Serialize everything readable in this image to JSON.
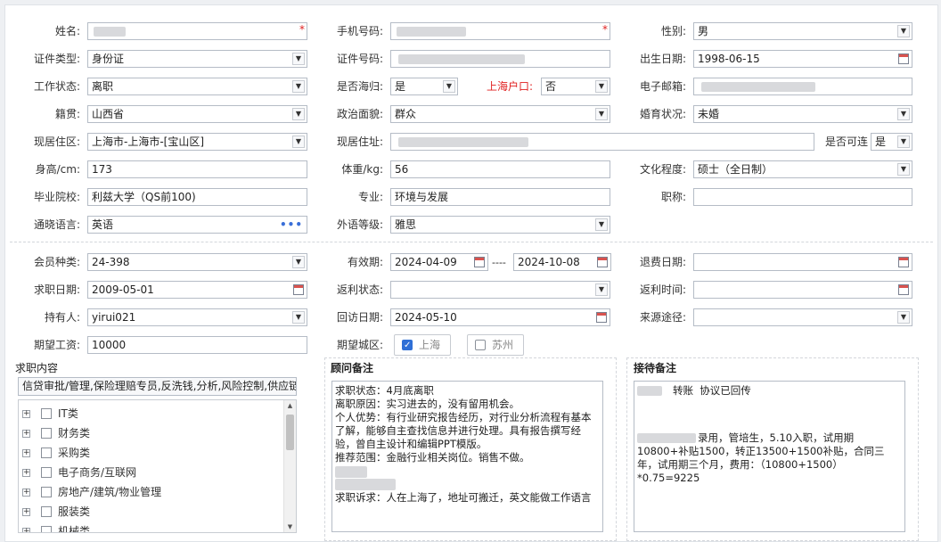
{
  "form": {
    "name": {
      "label": "姓名:"
    },
    "phone": {
      "label": "手机号码:"
    },
    "gender": {
      "label": "性别:",
      "value": "男"
    },
    "id_type": {
      "label": "证件类型:",
      "value": "身份证"
    },
    "id_number": {
      "label": "证件号码:"
    },
    "birth_date": {
      "label": "出生日期:",
      "value": "1998-06-15"
    },
    "work_status": {
      "label": "工作状态:",
      "value": "离职"
    },
    "returnee": {
      "label": "是否海归:",
      "value": "是"
    },
    "shanghai_hukou": {
      "label": "上海户口:",
      "value": "否"
    },
    "email": {
      "label": "电子邮箱:"
    },
    "native_place": {
      "label": "籍贯:",
      "value": "山西省"
    },
    "political_status": {
      "label": "政治面貌:",
      "value": "群众"
    },
    "marital_status": {
      "label": "婚育状况:",
      "value": "未婚"
    },
    "residence_area": {
      "label": "现居住区:",
      "value": "上海市-上海市-[宝山区]"
    },
    "residence_address": {
      "label": "现居住址:"
    },
    "contactable": {
      "label": "是否可连",
      "value": "是"
    },
    "height": {
      "label": "身高/cm:",
      "value": "173"
    },
    "weight": {
      "label": "体重/kg:",
      "value": "56"
    },
    "education": {
      "label": "文化程度:",
      "value": "硕士（全日制）"
    },
    "school": {
      "label": "毕业院校:",
      "value": "利兹大学（QS前100)"
    },
    "major": {
      "label": "专业:",
      "value": "环境与发展"
    },
    "title": {
      "label": "职称:",
      "value": ""
    },
    "languages": {
      "label": "通晓语言:",
      "value": "英语"
    },
    "language_level": {
      "label": "外语等级:",
      "value": "雅思"
    }
  },
  "membership": {
    "member_type": {
      "label": "会员种类:",
      "value": "24-398"
    },
    "valid_period": {
      "label": "有效期:",
      "from": "2024-04-09",
      "sep": "----",
      "to": "2024-10-08"
    },
    "refund_date": {
      "label": "退费日期:",
      "value": ""
    },
    "job_seek_date": {
      "label": "求职日期:",
      "value": "2009-05-01"
    },
    "rebate_status": {
      "label": "返利状态:",
      "value": ""
    },
    "rebate_time": {
      "label": "返利时间:",
      "value": ""
    },
    "holder": {
      "label": "持有人:",
      "value": "yirui021"
    },
    "visit_date": {
      "label": "回访日期:",
      "value": "2024-05-10"
    },
    "source": {
      "label": "来源途径:",
      "value": ""
    },
    "expected_salary": {
      "label": "期望工资:",
      "value": "10000"
    },
    "expected_city": {
      "label": "期望城区:",
      "options": [
        {
          "label": "上海",
          "checked": true
        },
        {
          "label": "苏州",
          "checked": false
        }
      ]
    }
  },
  "job_content": {
    "title": "求职内容",
    "summary": "信贷审批/管理,保险理赔专员,反洗钱,分析,风险控制,供应链",
    "tree": [
      "IT类",
      "财务类",
      "采购类",
      "电子商务/互联网",
      "房地产/建筑/物业管理",
      "服装类",
      "机械类"
    ]
  },
  "consultant_notes": {
    "title": "顾问备注",
    "lines": [
      "求职状态：4月底离职",
      "离职原因：实习进去的，没有留用机会。",
      "个人优势：有行业研究报告经历，对行业分析流程有基本了解，能够自主查找信息并进行处理。具有报告撰写经验，曾自主设计和编辑PPT模版。",
      "推荐范围：金融行业相关岗位。销售不做。",
      "",
      "求职诉求：人在上海了，地址可搬迁，英文能做工作语言"
    ]
  },
  "reception_notes": {
    "title": "接待备注",
    "line1": "转账  协议已回传",
    "line2": "录用，管培生，5.10入职，试用期10800+补贴1500，转正13500+1500补贴，合同三年，试用期三个月，费用：（10800+1500）*0.75=9225"
  },
  "icons": {
    "dropdown": "chevron-down-icon",
    "calendar": "calendar-icon",
    "more": "more-icon",
    "expand": "plus-icon"
  }
}
